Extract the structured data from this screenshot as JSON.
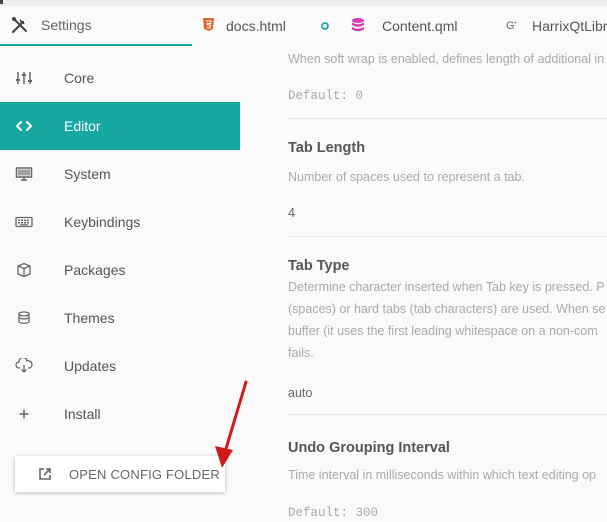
{
  "tabs": [
    {
      "label": "Settings",
      "icon": "tools-icon"
    },
    {
      "label": "docs.html",
      "icon": "html5-icon"
    },
    {
      "label": "Content.qml",
      "icon": "database-icon"
    },
    {
      "label": "HarrixQtLibrar",
      "icon": "cpp-icon"
    }
  ],
  "sidebar": {
    "items": [
      {
        "label": "Core",
        "icon": "sliders-icon"
      },
      {
        "label": "Editor",
        "icon": "code-icon",
        "active": true
      },
      {
        "label": "System",
        "icon": "monitor-icon"
      },
      {
        "label": "Keybindings",
        "icon": "keyboard-icon"
      },
      {
        "label": "Packages",
        "icon": "package-icon"
      },
      {
        "label": "Themes",
        "icon": "paint-bucket-icon"
      },
      {
        "label": "Updates",
        "icon": "cloud-download-icon"
      },
      {
        "label": "Install",
        "icon": "plus-icon"
      }
    ],
    "open_config_label": "OPEN CONFIG FOLDER"
  },
  "settings": {
    "softwrap_desc": "When soft wrap is enabled, defines length of additional in",
    "softwrap_default": "Default: 0",
    "tab_length_title": "Tab Length",
    "tab_length_desc": "Number of spaces used to represent a tab.",
    "tab_length_value": "4",
    "tab_type_title": "Tab Type",
    "tab_type_desc": [
      "Determine character inserted when Tab key is pressed. P",
      "(spaces) or hard tabs (tab characters) are used. When se",
      "buffer (it uses the first leading whitespace on a non-com",
      "fails."
    ],
    "tab_type_value": "auto",
    "undo_title": "Undo Grouping Interval",
    "undo_desc": "Time interval in milliseconds within which text editing op",
    "undo_default": "Default: 300"
  },
  "colors": {
    "accent": "#17a8a3",
    "arrow": "#d01a1a",
    "html_icon": "#e06a2c",
    "db_icon": "#d63bb1"
  }
}
